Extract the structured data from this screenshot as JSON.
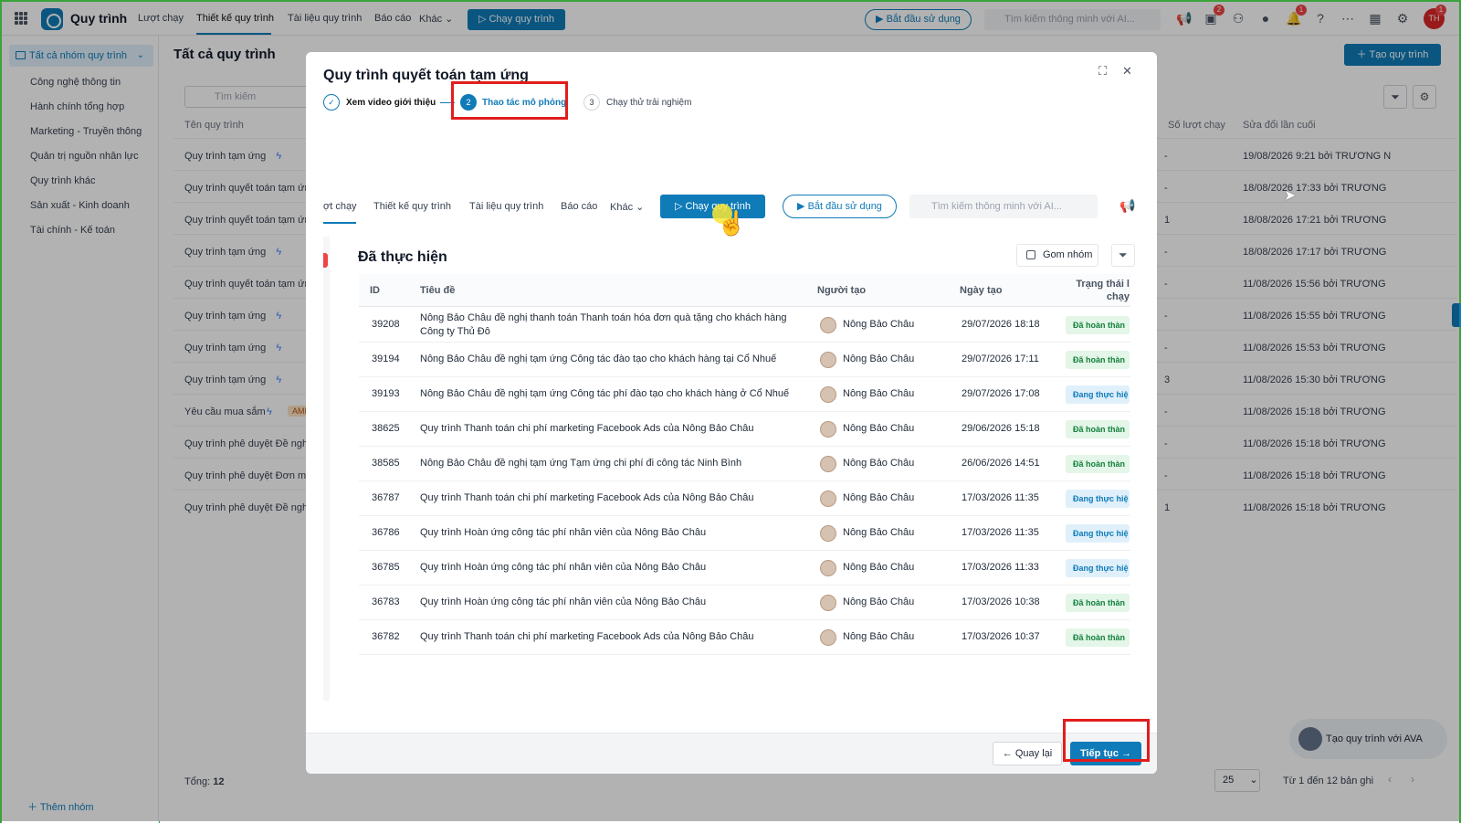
{
  "topbar": {
    "app_title": "Quy trình",
    "nav": [
      "Lượt chạy",
      "Thiết kế quy trình",
      "Tài liệu quy trình",
      "Báo cáo",
      "Khác"
    ],
    "run_button": "Chạy quy trình",
    "start_button": "Bắt đầu sử dụng",
    "search_placeholder": "Tìm kiếm thông minh với AI...",
    "badges": {
      "news": "2",
      "notifications": "1",
      "avatar": "1"
    },
    "avatar_initials": "TH"
  },
  "sidebar": {
    "group_head": "Tất cả nhóm quy trình",
    "items": [
      "Công nghệ thông tin",
      "Hành chính tổng hợp",
      "Marketing - Truyền thông",
      "Quản trị nguồn nhân lực",
      "Quy trình khác",
      "Sản xuất - Kinh doanh",
      "Tài chính - Kế toán"
    ],
    "add_group": "Thêm nhóm"
  },
  "main": {
    "page_title": "Tất cả quy trình",
    "create_button": "Tạo quy trình",
    "search_placeholder": "Tìm kiếm",
    "columns": {
      "name": "Tên quy trình",
      "runs": "Số lượt chạy",
      "modified": "Sửa đổi lần cuối"
    },
    "rows": [
      {
        "name": "Quy trình tạm ứng",
        "bolt": true,
        "runs": "-",
        "modified": "19/08/2026 9:21 bởi TRƯƠNG N"
      },
      {
        "name": "Quy trình quyết toán tạm ứng",
        "bolt": false,
        "runs": "-",
        "modified": "18/08/2026 17:33 bởi TRƯƠNG"
      },
      {
        "name": "Quy trình quyết toán tạm ứng",
        "bolt": false,
        "runs": "1",
        "modified": "18/08/2026 17:21 bởi TRƯƠNG"
      },
      {
        "name": "Quy trình tạm ứng",
        "bolt": true,
        "runs": "-",
        "modified": "18/08/2026 17:17 bởi TRƯƠNG"
      },
      {
        "name": "Quy trình quyết toán tạm ứng",
        "bolt": false,
        "runs": "-",
        "modified": "11/08/2026 15:56 bởi TRƯƠNG"
      },
      {
        "name": "Quy trình tạm ứng",
        "bolt": true,
        "runs": "-",
        "modified": "11/08/2026 15:55 bởi TRƯƠNG"
      },
      {
        "name": "Quy trình tạm ứng",
        "bolt": true,
        "runs": "-",
        "modified": "11/08/2026 15:53 bởi TRƯƠNG"
      },
      {
        "name": "Quy trình tạm ứng",
        "bolt": true,
        "runs": "3",
        "modified": "11/08/2026 15:30 bởi TRƯƠNG"
      },
      {
        "name": "Yêu cầu mua sắm",
        "bolt": true,
        "tag": "AMI",
        "runs": "-",
        "modified": "11/08/2026 15:18 bởi TRƯƠNG"
      },
      {
        "name": "Quy trình phê duyệt Đề nghị t",
        "bolt": false,
        "runs": "-",
        "modified": "11/08/2026 15:18 bởi TRƯƠNG"
      },
      {
        "name": "Quy trình phê duyệt Đơn mua",
        "bolt": false,
        "runs": "-",
        "modified": "11/08/2026 15:18 bởi TRƯƠNG"
      },
      {
        "name": "Quy trình phê duyệt Đề nghị c",
        "bolt": false,
        "runs": "1",
        "modified": "11/08/2026 15:18 bởi TRƯƠNG"
      }
    ],
    "total_label": "Tổng:",
    "total_value": "12",
    "page_size": "25",
    "pager_info": "Từ 1 đến 12 bản ghi",
    "ava_button": "Tạo quy trình với AVA"
  },
  "modal": {
    "title": "Quy trình quyết toán tạm ứng",
    "steps": [
      {
        "number": "",
        "label": "Xem video giới thiệu",
        "state": "done"
      },
      {
        "number": "2",
        "label": "Thao tác mô phỏng",
        "state": "active"
      },
      {
        "number": "3",
        "label": "Chạy thử trải nghiệm",
        "state": "idle"
      }
    ],
    "inner": {
      "nav": [
        "ợt chạy",
        "Thiết kế quy trình",
        "Tài liệu quy trình",
        "Báo cáo",
        "Khác"
      ],
      "run_button": "Chạy quy trình",
      "start_button": "Bắt đầu sử dụng",
      "search_placeholder": "Tìm kiếm thông minh với AI...",
      "section_title": "Đã thực hiện",
      "group_button": "Gom nhóm",
      "columns": {
        "id": "ID",
        "title": "Tiêu đề",
        "creator": "Người tạo",
        "created": "Ngày tạo",
        "status": "Trạng thái l chạy"
      },
      "rows": [
        {
          "id": "39208",
          "title": "Nông Bảo Châu đề nghị thanh toán Thanh toán hóa đơn quà tặng cho khách hàng Công ty Thủ Đô",
          "creator": "Nông Bảo Châu",
          "date": "29/07/2026 18:18",
          "status": "Đã hoàn thàn",
          "state": "done"
        },
        {
          "id": "39194",
          "title": "Nông Bảo Châu đề nghị tạm ứng Công tác đào tạo cho khách hàng tại Cổ Nhuế",
          "creator": "Nông Bảo Châu",
          "date": "29/07/2026 17:11",
          "status": "Đã hoàn thàn",
          "state": "done"
        },
        {
          "id": "39193",
          "title": "Nông Bảo Châu đề nghị tạm ứng Công tác phí đào tạo cho khách hàng ở Cổ Nhuế",
          "creator": "Nông Bảo Châu",
          "date": "29/07/2026 17:08",
          "status": "Đang thực hiệ",
          "state": "run"
        },
        {
          "id": "38625",
          "title": "Quy trình Thanh toán chi phí marketing Facebook Ads của Nông Bảo Châu",
          "creator": "Nông Bảo Châu",
          "date": "29/06/2026 15:18",
          "status": "Đã hoàn thàn",
          "state": "done"
        },
        {
          "id": "38585",
          "title": "Nông Bảo Châu đề nghị tạm ứng Tạm ứng chi phí đi công tác Ninh Bình",
          "creator": "Nông Bảo Châu",
          "date": "26/06/2026 14:51",
          "status": "Đã hoàn thàn",
          "state": "done"
        },
        {
          "id": "36787",
          "title": "Quy trình Thanh toán chi phí marketing Facebook Ads của Nông Bảo Châu",
          "creator": "Nông Bảo Châu",
          "date": "17/03/2026 11:35",
          "status": "Đang thực hiệ",
          "state": "run"
        },
        {
          "id": "36786",
          "title": "Quy trình Hoàn ứng công tác phí nhân viên của Nông Bảo Châu",
          "creator": "Nông Bảo Châu",
          "date": "17/03/2026 11:35",
          "status": "Đang thực hiệ",
          "state": "run"
        },
        {
          "id": "36785",
          "title": "Quy trình Hoàn ứng công tác phí nhân viên của Nông Bảo Châu",
          "creator": "Nông Bảo Châu",
          "date": "17/03/2026 11:33",
          "status": "Đang thực hiệ",
          "state": "run"
        },
        {
          "id": "36783",
          "title": "Quy trình Hoàn ứng công tác phí nhân viên của Nông Bảo Châu",
          "creator": "Nông Bảo Châu",
          "date": "17/03/2026 10:38",
          "status": "Đã hoàn thàn",
          "state": "done"
        },
        {
          "id": "36782",
          "title": "Quy trình Thanh toán chi phí marketing Facebook Ads của Nông Bảo Châu",
          "creator": "Nông Bảo Châu",
          "date": "17/03/2026 10:37",
          "status": "Đã hoàn thàn",
          "state": "done"
        }
      ]
    },
    "back_button": "Quay lại",
    "next_button": "Tiếp tục"
  }
}
